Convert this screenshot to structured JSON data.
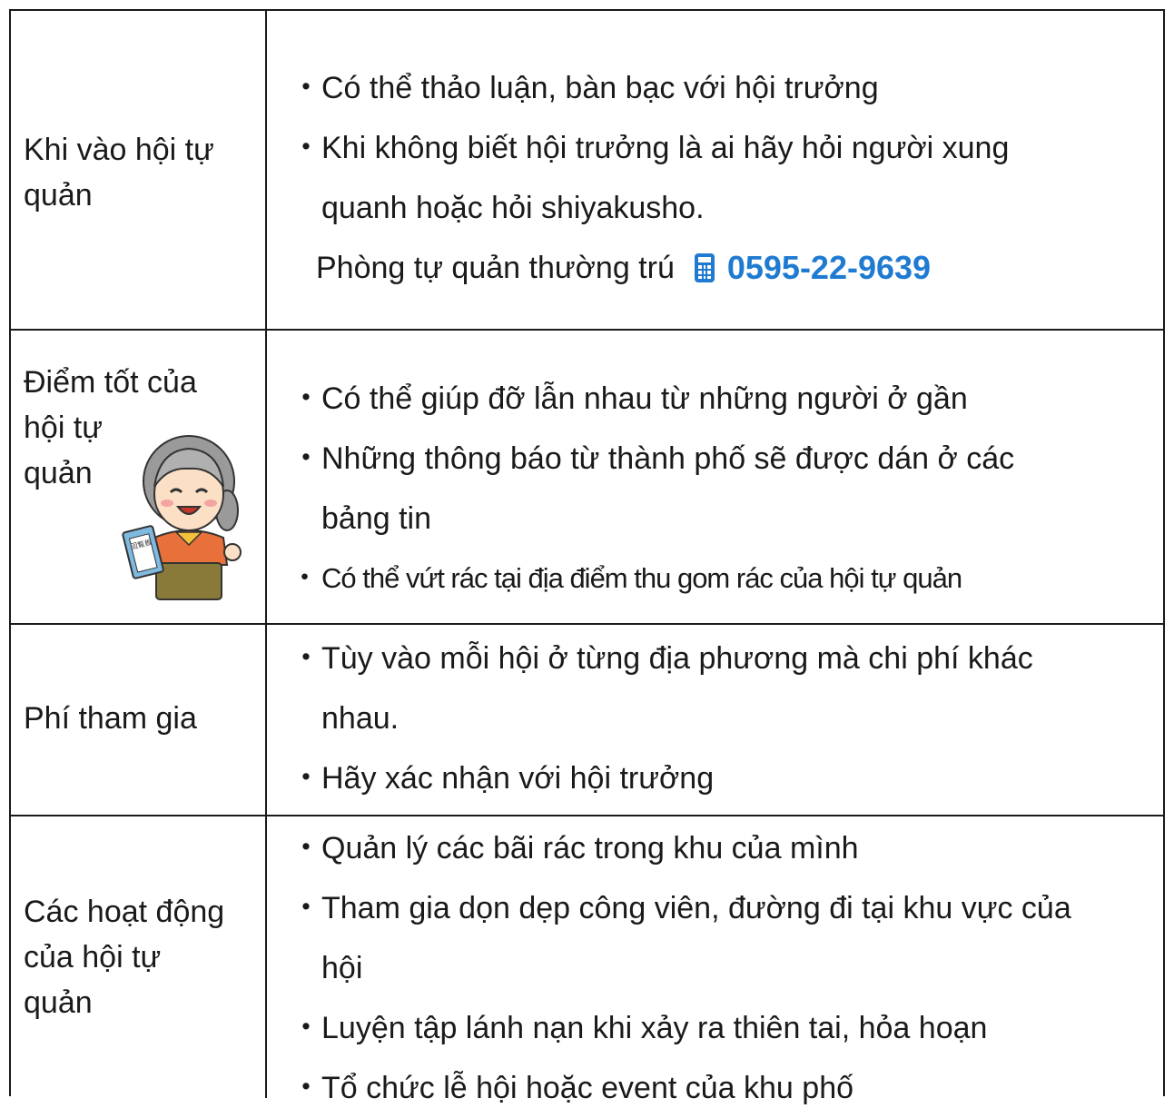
{
  "rows": [
    {
      "label_lines": [
        "Khi vào hội tự",
        "quản"
      ],
      "items": [
        {
          "lines": [
            "Có thể thảo luận, bàn bạc với hội trưởng"
          ]
        },
        {
          "lines": [
            "Khi không biết hội trưởng là ai hãy hỏi người xung",
            "quanh hoặc hỏi shiyakusho."
          ]
        }
      ],
      "phone_label": "Phòng tự quản thường trú",
      "phone_number": "0595-22-9639",
      "phone_icon": "phone-icon"
    },
    {
      "label_lines": [
        "Điểm tốt của",
        "hội tự",
        "quản"
      ],
      "items": [
        {
          "lines": [
            "Có thể giúp đỡ lẫn nhau từ những người ở gần"
          ]
        },
        {
          "lines": [
            "Những thông báo từ thành phố sẽ được dán ở các",
            "bảng tin"
          ]
        },
        {
          "lines": [
            "Có thể vứt rác tại địa điểm thu gom rác của hội tự quản"
          ]
        }
      ],
      "illustration": "grandma-holding-circular-board",
      "illustration_text": "回覧板"
    },
    {
      "label_lines": [
        "Phí tham gia"
      ],
      "items": [
        {
          "lines": [
            "Tùy vào mỗi hội ở từng địa phương mà chi phí khác",
            "nhau."
          ]
        },
        {
          "lines": [
            "Hãy xác nhận với hội trưởng"
          ]
        }
      ]
    },
    {
      "label_lines": [
        "Các hoạt động",
        "của hội tự",
        "quản"
      ],
      "items": [
        {
          "lines": [
            "Quản lý các bãi rác trong khu của mình"
          ]
        },
        {
          "lines": [
            "Tham gia dọn dẹp công viên, đường đi tại khu vực của",
            "hội"
          ]
        },
        {
          "lines": [
            "Luyện tập lánh nạn khi xảy ra thiên tai, hỏa hoạn"
          ]
        },
        {
          "lines": [
            "Tổ chức lễ hội hoặc event của khu phố"
          ]
        }
      ]
    }
  ],
  "bullet": "・",
  "colors": {
    "accent": "#1f7bd1",
    "text": "#1a1a1a",
    "border": "#1a1a1a"
  }
}
